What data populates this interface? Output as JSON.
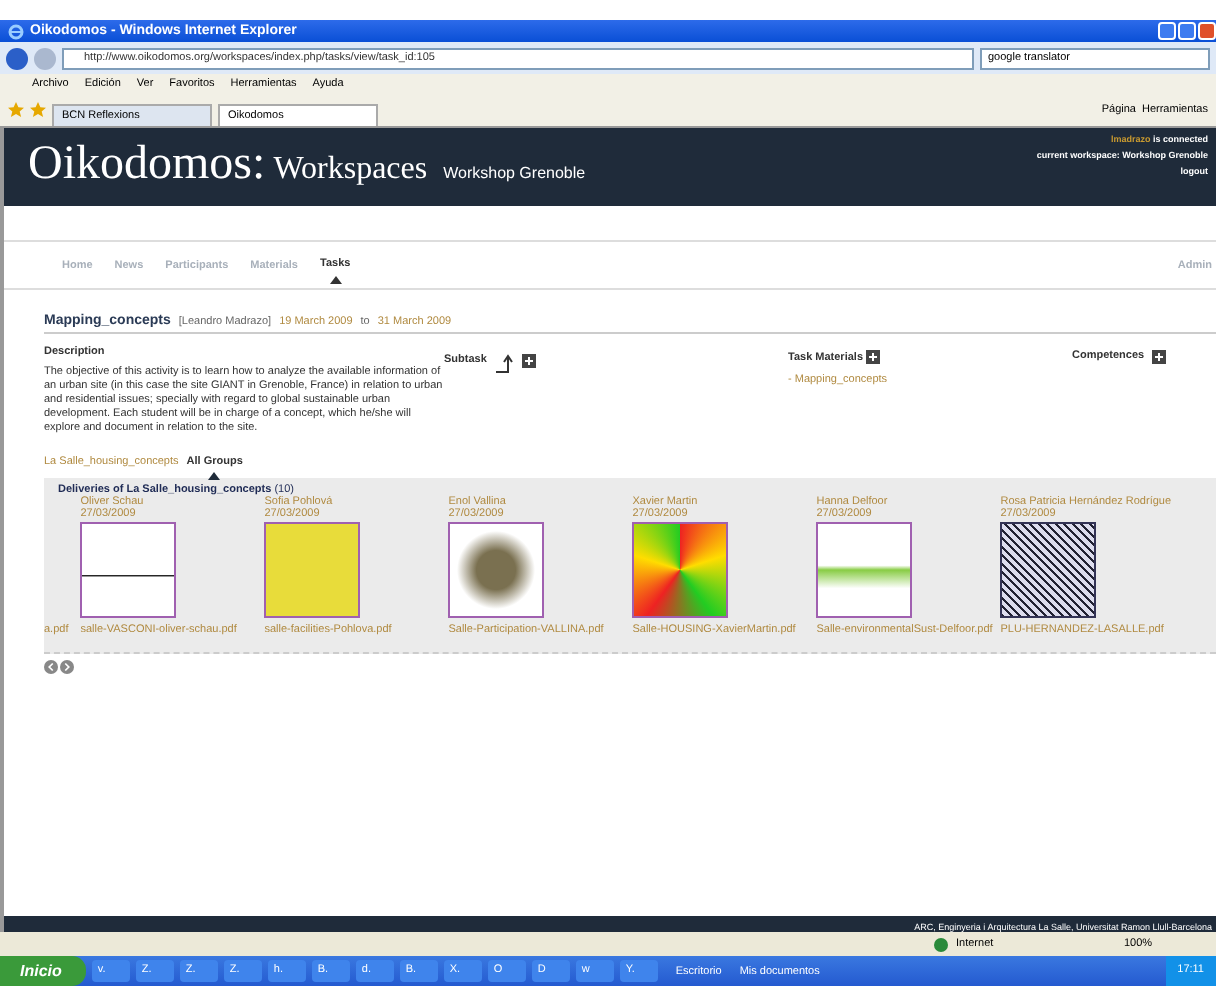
{
  "window": {
    "title": "Oikodomos - Windows Internet Explorer"
  },
  "address_bar": {
    "url": "http://www.oikodomos.org/workspaces/index.php/tasks/view/task_id:105",
    "search_value": "google translator"
  },
  "menu": [
    "Archivo",
    "Edición",
    "Ver",
    "Favoritos",
    "Herramientas",
    "Ayuda"
  ],
  "browser_tabs": [
    {
      "label": "BCN Reflexions",
      "selected": false
    },
    {
      "label": "Oikodomos",
      "selected": true
    }
  ],
  "toolbar": [
    "Página",
    "Herramientas"
  ],
  "site": {
    "logo": "Oikodomos:",
    "logo_sub": "Workspaces",
    "workspace": "Workshop Grenoble",
    "user": "lmadrazo",
    "user_suffix": "is connected",
    "current": "current workspace: Workshop Grenoble",
    "logout": "logout"
  },
  "nav": [
    {
      "label": "Home",
      "selected": false
    },
    {
      "label": "News",
      "selected": false
    },
    {
      "label": "Participants",
      "selected": false
    },
    {
      "label": "Materials",
      "selected": false
    },
    {
      "label": "Tasks",
      "selected": true
    }
  ],
  "admin": "Admin",
  "task": {
    "title": "Mapping_concepts",
    "author": "[Leandro Madrazo]",
    "start": "19 March 2009",
    "to": "to",
    "end": "31 March 2009",
    "description_heading": "Description",
    "description": "The objective of this activity is to learn how to analyze the available information of an urban site (in this case the site GIANT in Grenoble, France) in relation to urban and residential issues; specially with regard to global sustainable urban development. Each student will be in charge of a concept, which he/she will explore and document in relation to the site.",
    "subtask": "Subtask",
    "materials_heading": "Task Materials",
    "materials": [
      "- Mapping_concepts"
    ],
    "competences": "Competences"
  },
  "group_tabs": [
    {
      "label": "La Salle_housing_concepts",
      "selected": false
    },
    {
      "label": "All Groups",
      "selected": true
    }
  ],
  "deliveries": {
    "heading": "Deliveries of La Salle_housing_concepts",
    "count": "(10)",
    "cut_file": "a.pdf",
    "items": [
      {
        "author": "Oliver Schau",
        "date": "27/03/2009",
        "file": "salle-VASCONI-oliver-schau.pdf",
        "kind": "sketch"
      },
      {
        "author": "Sofia Pohlová",
        "date": "27/03/2009",
        "file": "salle-facilities-Pohlova.pdf",
        "kind": "yellow"
      },
      {
        "author": "Enol Vallina",
        "date": "27/03/2009",
        "file": "Salle-Participation-VALLINA.pdf",
        "kind": "map"
      },
      {
        "author": "Xavier Martin",
        "date": "27/03/2009",
        "file": "Salle-HOUSING-XavierMartin.pdf",
        "kind": "cube"
      },
      {
        "author": "Hanna Delfoor",
        "date": "27/03/2009",
        "file": "Salle-environmentalSust-Delfoor.pdf",
        "kind": "green"
      },
      {
        "author": "Rosa Patricia Hernández Rodrígue",
        "date": "27/03/2009",
        "file": "PLU-HERNANDEZ-LASALLE.pdf",
        "kind": "plan"
      }
    ]
  },
  "footer": "ARC, Enginyeria i Arquitectura La Salle, Universitat Ramon Llull-Barcelona",
  "status_bar": {
    "zone": "Internet",
    "zoom": "100%"
  },
  "taskbar": {
    "start": "Inicio",
    "items": [
      "v.",
      "Z.",
      "Z.",
      "Z.",
      "h.",
      "B.",
      "d.",
      "B.",
      "X.",
      "O",
      "D",
      "w",
      "Y."
    ],
    "desktop": "Escritorio",
    "folder": "Mis documentos",
    "clock": "17:11"
  }
}
